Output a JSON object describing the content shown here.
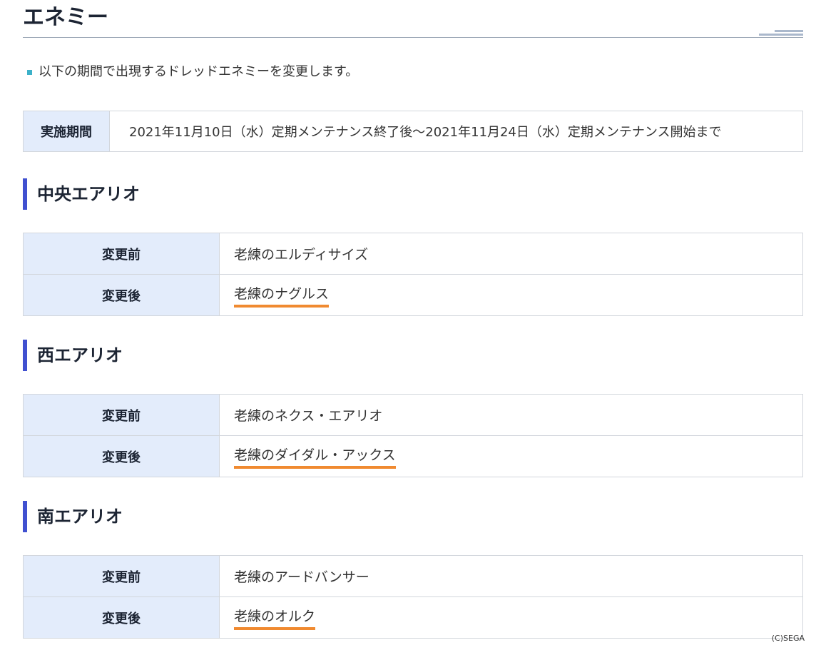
{
  "page": {
    "title": "エネミー",
    "intro": "以下の期間で出現するドレッドエネミーを変更します。"
  },
  "period": {
    "label": "実施期間",
    "value": "2021年11月10日（水）定期メンテナンス終了後～2021年11月24日（水）定期メンテナンス開始まで"
  },
  "areas": [
    {
      "name": "中央エアリオ",
      "before_label": "変更前",
      "before": "老練のエルディサイズ",
      "after_label": "変更後",
      "after": "老練のナグルス"
    },
    {
      "name": "西エアリオ",
      "before_label": "変更前",
      "before": "老練のネクス・エアリオ",
      "after_label": "変更後",
      "after": "老練のダイダル・アックス"
    },
    {
      "name": "南エアリオ",
      "before_label": "変更前",
      "before": "老練のアードバンサー",
      "after_label": "変更後",
      "after": "老練のオルク"
    }
  ],
  "footer": {
    "copyright": "(C)SEGA"
  },
  "colors": {
    "accent_bar": "#4050d0",
    "highlight_underline": "#f08a30",
    "label_bg": "#e3ecfb",
    "bullet": "#3cb1c9"
  }
}
